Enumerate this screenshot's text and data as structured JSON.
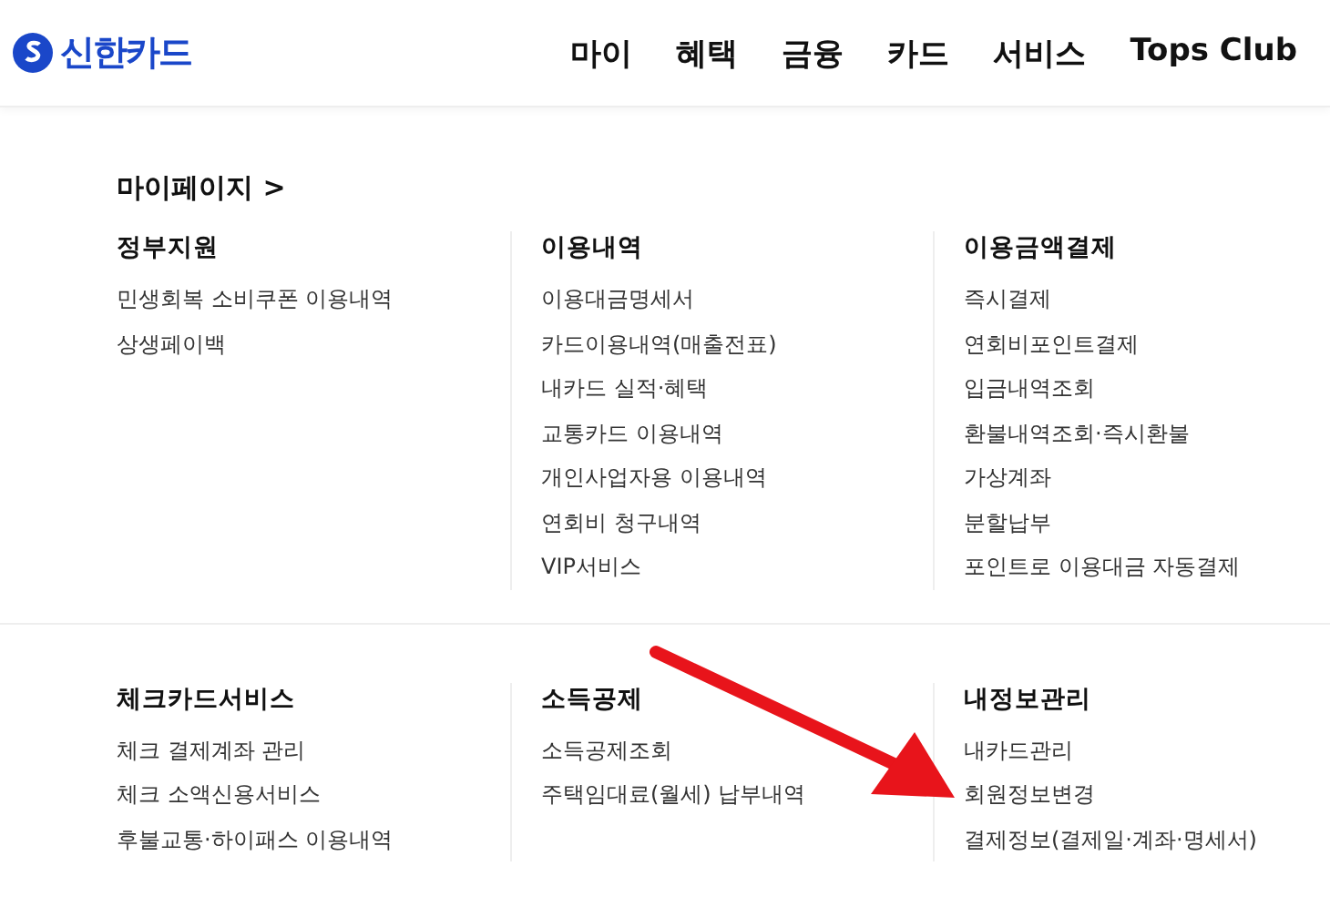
{
  "header": {
    "logo": "신한카드",
    "nav": [
      "마이",
      "혜택",
      "금융",
      "카드",
      "서비스",
      "Tops Club"
    ]
  },
  "page_title": "마이페이지 >",
  "sections": [
    [
      {
        "title": "정부지원",
        "items": [
          "민생회복 소비쿠폰 이용내역",
          "상생페이백"
        ]
      },
      {
        "title": "이용내역",
        "items": [
          "이용대금명세서",
          "카드이용내역(매출전표)",
          "내카드 실적·혜택",
          "교통카드 이용내역",
          "개인사업자용 이용내역",
          "연회비 청구내역",
          "VIP서비스"
        ]
      },
      {
        "title": "이용금액결제",
        "items": [
          "즉시결제",
          "연회비포인트결제",
          "입금내역조회",
          "환불내역조회·즉시환불",
          "가상계좌",
          "분할납부",
          "포인트로 이용대금 자동결제"
        ]
      }
    ],
    [
      {
        "title": "체크카드서비스",
        "items": [
          "체크 결제계좌 관리",
          "체크 소액신용서비스",
          "후불교통·하이패스 이용내역"
        ]
      },
      {
        "title": "소득공제",
        "items": [
          "소득공제조회",
          "주택임대료(월세) 납부내역"
        ]
      },
      {
        "title": "내정보관리",
        "items": [
          "내카드관리",
          "회원정보변경",
          "결제정보(결제일·계좌·명세서)"
        ]
      }
    ]
  ]
}
